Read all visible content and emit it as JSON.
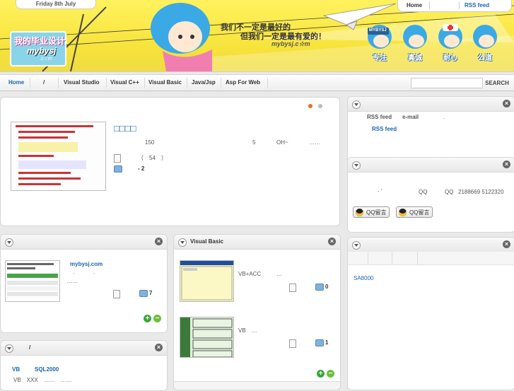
{
  "header": {
    "date": "Friday 8th July",
    "top_nav": {
      "home": "Home",
      "rss": "RSS feed"
    },
    "logo": {
      "line1": "我的毕业设计",
      "line2": "mybysj",
      "line3": ".c☆m"
    },
    "slogan": {
      "line1": "我们不一定是最好的",
      "line2": "但我们一定是最有爱的！",
      "line3": "mybysj.c☆m"
    },
    "mascot_labels": [
      "专注",
      "真诚",
      "耐心",
      "公道"
    ],
    "mascot_badge": "MYBYSJ"
  },
  "menu": {
    "items": [
      "Home",
      "/",
      "Visual Studio",
      "Visual C++",
      "Visual Basic",
      "Java/Jsp",
      "Asp For Web"
    ],
    "search_placeholder": "",
    "search_button": "SEARCH"
  },
  "featured": {
    "title": "□□□□",
    "meta": [
      "150",
      "5",
      "OH~",
      "……"
    ],
    "views": "（　54　）",
    "comments": "- 2"
  },
  "rss_panel": {
    "label_rss": "RSS feed",
    "label_email": "e-mail",
    "dot": ".",
    "link": "RSS feed"
  },
  "qq_panel": {
    "mark": "- '",
    "qq_label1": "QQ",
    "qq_label2": "QQ",
    "qq_numbers": "2188669  5122320",
    "buttons": [
      "QQ留言",
      "QQ留言"
    ]
  },
  "tags_panel": {
    "tag": "SA8000"
  },
  "left_panel1": {
    "link": "mybysj.com",
    "dot1": ".",
    "dot2": ".",
    "ellipsis": "……",
    "comments": "7"
  },
  "left_panel2": {
    "title": "/",
    "col1": "VB",
    "col2": "SQL2000",
    "line": "VB　XXX　……　……"
  },
  "vb_panel": {
    "title": "Visual Basic",
    "item1": {
      "text": "VB+ACC",
      "ellipsis": "…",
      "comments": "0"
    },
    "item2": {
      "text": "VB　…",
      "comments": "1"
    }
  }
}
